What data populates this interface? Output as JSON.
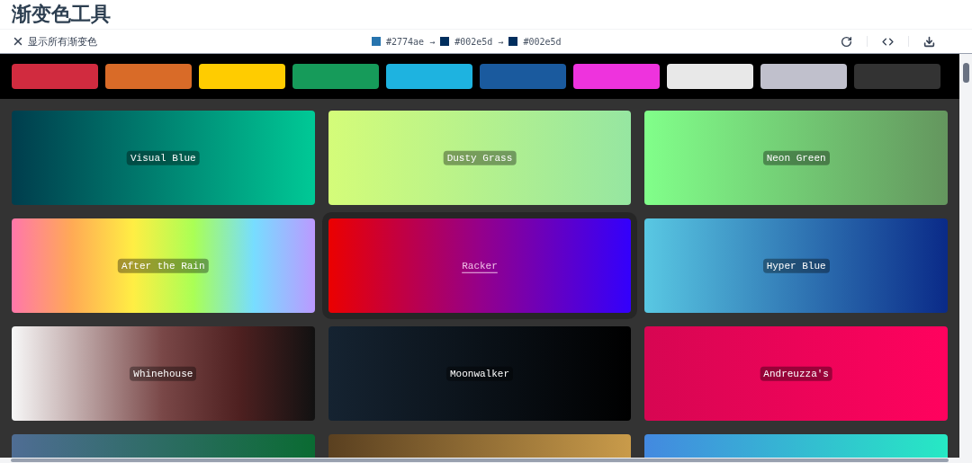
{
  "title": "渐变色工具",
  "toolbar": {
    "toggle_label": "显示所有渐变色",
    "stops": [
      {
        "color": "#2774ae",
        "hex": "#2774ae",
        "arrow": "→"
      },
      {
        "color": "#002e5d",
        "hex": "#002e5d",
        "arrow": "→"
      },
      {
        "color": "#002e5d",
        "hex": "#002e5d"
      }
    ]
  },
  "swatches": [
    {
      "color": "#d12b3f"
    },
    {
      "color": "#d96b28"
    },
    {
      "color": "#ffcc00"
    },
    {
      "color": "#169b5a"
    },
    {
      "color": "#1eb3e0"
    },
    {
      "color": "#1a5a9e"
    },
    {
      "color": "#ee33dd"
    },
    {
      "color": "#e8e8e8"
    },
    {
      "color": "#c0c0cc"
    },
    {
      "color": "#333333"
    }
  ],
  "gradients": [
    {
      "name": "Visual Blue",
      "stops": [
        {
          "color": "#003d4d"
        },
        {
          "color": "#00c996"
        }
      ],
      "selected": false
    },
    {
      "name": "Dusty Grass",
      "stops": [
        {
          "color": "#d4fc79"
        },
        {
          "color": "#96e6a1"
        }
      ],
      "selected": false
    },
    {
      "name": "Neon Green",
      "stops": [
        {
          "color": "#81ff8a"
        },
        {
          "color": "#64965e"
        }
      ],
      "selected": false
    },
    {
      "name": "After the Rain",
      "stops": [
        {
          "color": "#ff77aa"
        },
        {
          "color": "#ffaa55"
        },
        {
          "color": "#ffee44"
        },
        {
          "color": "#aaff55"
        },
        {
          "color": "#77ddff"
        },
        {
          "color": "#bb99ff"
        }
      ],
      "selected": false
    },
    {
      "name": "Racker",
      "stops": [
        {
          "color": "#eb0000"
        },
        {
          "color": "#95008a"
        },
        {
          "color": "#3300fc"
        }
      ],
      "selected": true
    },
    {
      "name": "Hyper Blue",
      "stops": [
        {
          "color": "#59c8e3"
        },
        {
          "color": "#0a2a88"
        }
      ],
      "selected": false
    },
    {
      "name": "Whinehouse",
      "stops": [
        {
          "color": "#f7f7f7"
        },
        {
          "color": "#b9a0a0"
        },
        {
          "color": "#794747"
        },
        {
          "color": "#4e2020"
        },
        {
          "color": "#111111"
        }
      ],
      "selected": false
    },
    {
      "name": "Moonwalker",
      "stops": [
        {
          "color": "#152331"
        },
        {
          "color": "#000000"
        }
      ],
      "selected": false
    },
    {
      "name": "Andreuzza's",
      "stops": [
        {
          "color": "#d70652"
        },
        {
          "color": "#ff025e"
        }
      ],
      "selected": false
    },
    {
      "stops": [
        {
          "color": "#4f6d94"
        },
        {
          "color": "#0a6b32"
        }
      ],
      "selected": false
    },
    {
      "stops": [
        {
          "color": "#5a4020"
        },
        {
          "color": "#c99b4a"
        }
      ],
      "selected": false
    },
    {
      "stops": [
        {
          "color": "#4389e0"
        },
        {
          "color": "#26e9c4"
        }
      ],
      "selected": false
    }
  ]
}
